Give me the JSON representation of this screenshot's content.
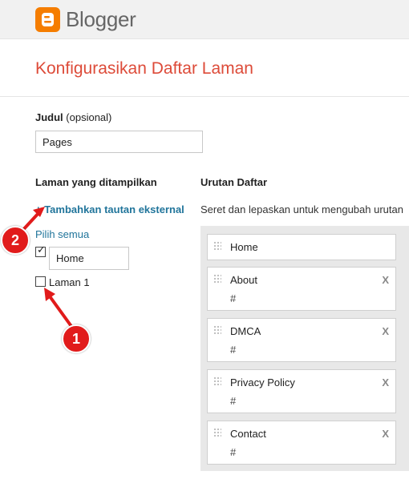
{
  "header": {
    "app_name": "Blogger",
    "logo_icon": "blogger-logo-icon",
    "brand_color": "#f57d00"
  },
  "page": {
    "title": "Konfigurasikan Daftar Laman",
    "title_color": "#dd4b39"
  },
  "title_field": {
    "label": "Judul",
    "optional": "(opsional)",
    "value": "Pages"
  },
  "left_column": {
    "heading": "Laman yang ditampilkan",
    "add_link": "+ Tambahkan tautan eksternal",
    "select_all": "Pilih semua",
    "items": [
      {
        "checked": true,
        "value": "Home"
      },
      {
        "checked": false,
        "label": "Laman 1"
      }
    ]
  },
  "right_column": {
    "heading": "Urutan Daftar",
    "hint": "Seret dan lepaskan untuk mengubah urutan",
    "items": [
      {
        "name": "Home"
      },
      {
        "name": "About",
        "url": "#",
        "remove": "X"
      },
      {
        "name": "DMCA",
        "url": "#",
        "remove": "X"
      },
      {
        "name": "Privacy Policy",
        "url": "#",
        "remove": "X"
      },
      {
        "name": "Contact",
        "url": "#",
        "remove": "X"
      }
    ]
  },
  "annotations": {
    "marker_1": "1",
    "marker_2": "2",
    "color": "#e11b1b"
  }
}
